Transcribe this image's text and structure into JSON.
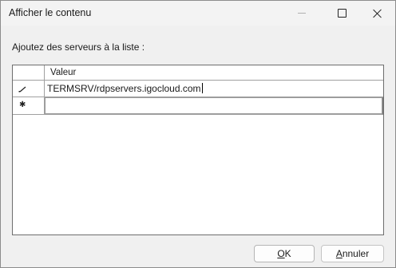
{
  "window": {
    "title": "Afficher le contenu"
  },
  "dialog": {
    "prompt": "Ajoutez des serveurs à la liste :"
  },
  "grid": {
    "column_header": "Valeur",
    "rows": [
      {
        "value": "TERMSRV/rdpservers.igocloud.com",
        "row_icon": "pencil-icon"
      },
      {
        "value": "",
        "row_icon": "new-row-star-icon"
      }
    ]
  },
  "buttons": {
    "ok": {
      "mnemonic": "O",
      "rest": "K"
    },
    "cancel": {
      "mnemonic": "A",
      "rest": "nnuler"
    }
  },
  "titlebar_icons": [
    "minimize-icon",
    "maximize-icon",
    "close-icon"
  ]
}
